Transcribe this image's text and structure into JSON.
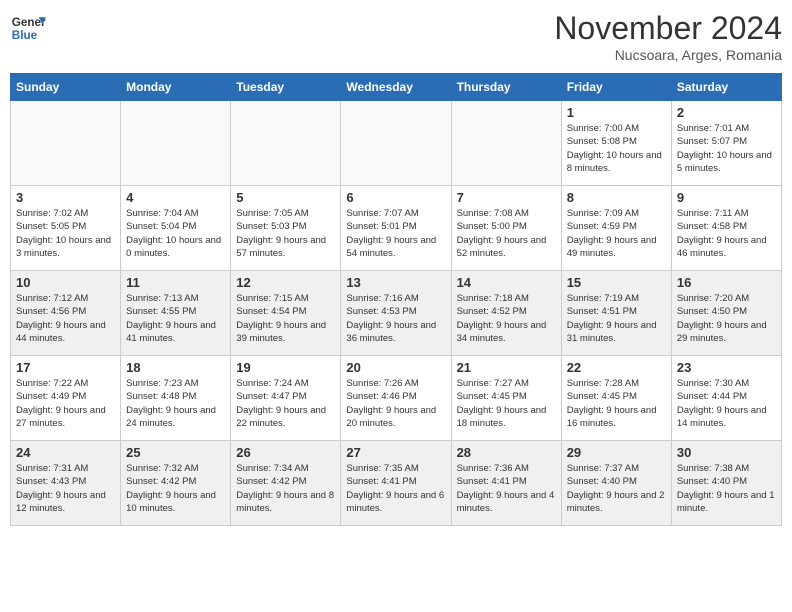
{
  "header": {
    "logo_line1": "General",
    "logo_line2": "Blue",
    "month_title": "November 2024",
    "location": "Nucsoara, Arges, Romania"
  },
  "weekdays": [
    "Sunday",
    "Monday",
    "Tuesday",
    "Wednesday",
    "Thursday",
    "Friday",
    "Saturday"
  ],
  "weeks": [
    [
      {
        "day": "",
        "info": "",
        "empty": true
      },
      {
        "day": "",
        "info": "",
        "empty": true
      },
      {
        "day": "",
        "info": "",
        "empty": true
      },
      {
        "day": "",
        "info": "",
        "empty": true
      },
      {
        "day": "",
        "info": "",
        "empty": true
      },
      {
        "day": "1",
        "info": "Sunrise: 7:00 AM\nSunset: 5:08 PM\nDaylight: 10 hours\nand 8 minutes.",
        "empty": false
      },
      {
        "day": "2",
        "info": "Sunrise: 7:01 AM\nSunset: 5:07 PM\nDaylight: 10 hours\nand 5 minutes.",
        "empty": false
      }
    ],
    [
      {
        "day": "3",
        "info": "Sunrise: 7:02 AM\nSunset: 5:05 PM\nDaylight: 10 hours\nand 3 minutes.",
        "empty": false
      },
      {
        "day": "4",
        "info": "Sunrise: 7:04 AM\nSunset: 5:04 PM\nDaylight: 10 hours\nand 0 minutes.",
        "empty": false
      },
      {
        "day": "5",
        "info": "Sunrise: 7:05 AM\nSunset: 5:03 PM\nDaylight: 9 hours\nand 57 minutes.",
        "empty": false
      },
      {
        "day": "6",
        "info": "Sunrise: 7:07 AM\nSunset: 5:01 PM\nDaylight: 9 hours\nand 54 minutes.",
        "empty": false
      },
      {
        "day": "7",
        "info": "Sunrise: 7:08 AM\nSunset: 5:00 PM\nDaylight: 9 hours\nand 52 minutes.",
        "empty": false
      },
      {
        "day": "8",
        "info": "Sunrise: 7:09 AM\nSunset: 4:59 PM\nDaylight: 9 hours\nand 49 minutes.",
        "empty": false
      },
      {
        "day": "9",
        "info": "Sunrise: 7:11 AM\nSunset: 4:58 PM\nDaylight: 9 hours\nand 46 minutes.",
        "empty": false
      }
    ],
    [
      {
        "day": "10",
        "info": "Sunrise: 7:12 AM\nSunset: 4:56 PM\nDaylight: 9 hours\nand 44 minutes.",
        "empty": false
      },
      {
        "day": "11",
        "info": "Sunrise: 7:13 AM\nSunset: 4:55 PM\nDaylight: 9 hours\nand 41 minutes.",
        "empty": false
      },
      {
        "day": "12",
        "info": "Sunrise: 7:15 AM\nSunset: 4:54 PM\nDaylight: 9 hours\nand 39 minutes.",
        "empty": false
      },
      {
        "day": "13",
        "info": "Sunrise: 7:16 AM\nSunset: 4:53 PM\nDaylight: 9 hours\nand 36 minutes.",
        "empty": false
      },
      {
        "day": "14",
        "info": "Sunrise: 7:18 AM\nSunset: 4:52 PM\nDaylight: 9 hours\nand 34 minutes.",
        "empty": false
      },
      {
        "day": "15",
        "info": "Sunrise: 7:19 AM\nSunset: 4:51 PM\nDaylight: 9 hours\nand 31 minutes.",
        "empty": false
      },
      {
        "day": "16",
        "info": "Sunrise: 7:20 AM\nSunset: 4:50 PM\nDaylight: 9 hours\nand 29 minutes.",
        "empty": false
      }
    ],
    [
      {
        "day": "17",
        "info": "Sunrise: 7:22 AM\nSunset: 4:49 PM\nDaylight: 9 hours\nand 27 minutes.",
        "empty": false
      },
      {
        "day": "18",
        "info": "Sunrise: 7:23 AM\nSunset: 4:48 PM\nDaylight: 9 hours\nand 24 minutes.",
        "empty": false
      },
      {
        "day": "19",
        "info": "Sunrise: 7:24 AM\nSunset: 4:47 PM\nDaylight: 9 hours\nand 22 minutes.",
        "empty": false
      },
      {
        "day": "20",
        "info": "Sunrise: 7:26 AM\nSunset: 4:46 PM\nDaylight: 9 hours\nand 20 minutes.",
        "empty": false
      },
      {
        "day": "21",
        "info": "Sunrise: 7:27 AM\nSunset: 4:45 PM\nDaylight: 9 hours\nand 18 minutes.",
        "empty": false
      },
      {
        "day": "22",
        "info": "Sunrise: 7:28 AM\nSunset: 4:45 PM\nDaylight: 9 hours\nand 16 minutes.",
        "empty": false
      },
      {
        "day": "23",
        "info": "Sunrise: 7:30 AM\nSunset: 4:44 PM\nDaylight: 9 hours\nand 14 minutes.",
        "empty": false
      }
    ],
    [
      {
        "day": "24",
        "info": "Sunrise: 7:31 AM\nSunset: 4:43 PM\nDaylight: 9 hours\nand 12 minutes.",
        "empty": false
      },
      {
        "day": "25",
        "info": "Sunrise: 7:32 AM\nSunset: 4:42 PM\nDaylight: 9 hours\nand 10 minutes.",
        "empty": false
      },
      {
        "day": "26",
        "info": "Sunrise: 7:34 AM\nSunset: 4:42 PM\nDaylight: 9 hours\nand 8 minutes.",
        "empty": false
      },
      {
        "day": "27",
        "info": "Sunrise: 7:35 AM\nSunset: 4:41 PM\nDaylight: 9 hours\nand 6 minutes.",
        "empty": false
      },
      {
        "day": "28",
        "info": "Sunrise: 7:36 AM\nSunset: 4:41 PM\nDaylight: 9 hours\nand 4 minutes.",
        "empty": false
      },
      {
        "day": "29",
        "info": "Sunrise: 7:37 AM\nSunset: 4:40 PM\nDaylight: 9 hours\nand 2 minutes.",
        "empty": false
      },
      {
        "day": "30",
        "info": "Sunrise: 7:38 AM\nSunset: 4:40 PM\nDaylight: 9 hours\nand 1 minute.",
        "empty": false
      }
    ]
  ]
}
